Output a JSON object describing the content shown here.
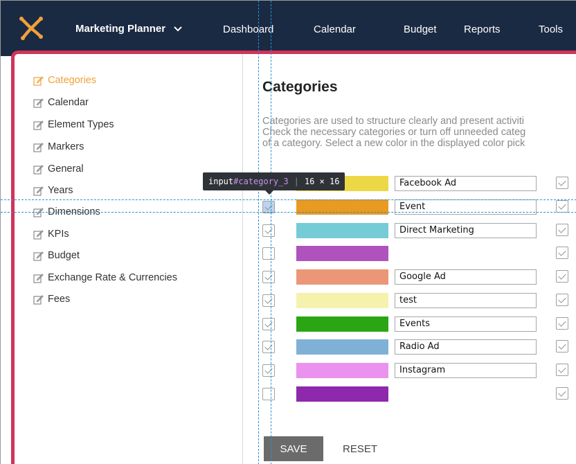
{
  "nav": {
    "brand": "Marketing Planner",
    "links": [
      "Dashboard",
      "Calendar",
      "Budget",
      "Reports",
      "Tools"
    ],
    "bg_color": "#1b2a43",
    "logo_color": "#f0a13a"
  },
  "sidebar": {
    "items": [
      {
        "label": "Categories",
        "active": true
      },
      {
        "label": "Calendar"
      },
      {
        "label": "Element Types"
      },
      {
        "label": "Markers"
      },
      {
        "label": "General"
      },
      {
        "label": "Years"
      },
      {
        "label": "Dimensions"
      },
      {
        "label": "KPIs"
      },
      {
        "label": "Budget"
      },
      {
        "label": "Exchange Rate & Currencies"
      },
      {
        "label": "Fees"
      }
    ],
    "active_color": "#f0a13a"
  },
  "main": {
    "title": "Categories",
    "description": [
      "Categories are used to structure clearly and present activiti",
      "Check the necessary categories or turn off unneeded categ",
      "of a category. Select a new color in the displayed color pick"
    ],
    "rows": [
      {
        "checked": true,
        "color": "#ecd844",
        "name": "Facebook Ad",
        "enabled": true
      },
      {
        "checked": true,
        "color": "#e89a23",
        "name": "Event",
        "enabled": true
      },
      {
        "checked": true,
        "color": "#75ccd6",
        "name": "Direct Marketing",
        "enabled": true
      },
      {
        "checked": false,
        "color": "#b052be",
        "name": "",
        "enabled": true
      },
      {
        "checked": true,
        "color": "#ec9678",
        "name": "Google Ad",
        "enabled": true
      },
      {
        "checked": true,
        "color": "#f5f2ae",
        "name": "test",
        "enabled": true
      },
      {
        "checked": true,
        "color": "#2aa615",
        "name": "Events",
        "enabled": true
      },
      {
        "checked": true,
        "color": "#7fb1d7",
        "name": "Radio Ad",
        "enabled": true
      },
      {
        "checked": true,
        "color": "#eb91ee",
        "name": "Instagram",
        "enabled": true
      },
      {
        "checked": false,
        "color": "#8e28ac",
        "name": "",
        "enabled": true
      }
    ],
    "save_label": "SAVE",
    "reset_label": "RESET"
  },
  "devtools": {
    "selector_tag": "input",
    "selector_id": "#category_3",
    "size": "16 × 16"
  },
  "accent_border": "#d2335b"
}
